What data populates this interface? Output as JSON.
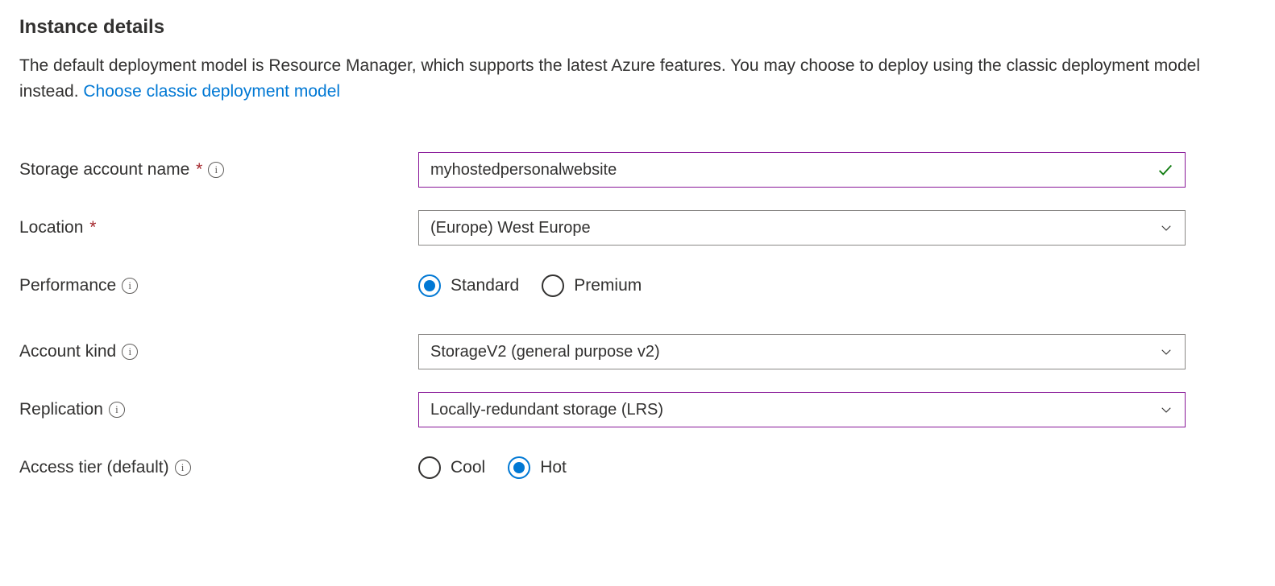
{
  "section": {
    "heading": "Instance details",
    "description": "The default deployment model is Resource Manager, which supports the latest Azure features. You may choose to deploy using the classic deployment model instead.  ",
    "linkText": "Choose classic deployment model"
  },
  "fields": {
    "storageAccountName": {
      "label": "Storage account name",
      "required": true,
      "hasInfo": true,
      "value": "myhostedpersonalwebsite",
      "valid": true
    },
    "location": {
      "label": "Location",
      "required": true,
      "hasInfo": false,
      "value": "(Europe) West Europe"
    },
    "performance": {
      "label": "Performance",
      "hasInfo": true,
      "options": {
        "standard": "Standard",
        "premium": "Premium"
      },
      "selected": "standard"
    },
    "accountKind": {
      "label": "Account kind",
      "hasInfo": true,
      "value": "StorageV2 (general purpose v2)"
    },
    "replication": {
      "label": "Replication",
      "hasInfo": true,
      "value": "Locally-redundant storage (LRS)"
    },
    "accessTier": {
      "label": "Access tier (default)",
      "hasInfo": true,
      "options": {
        "cool": "Cool",
        "hot": "Hot"
      },
      "selected": "hot"
    }
  }
}
